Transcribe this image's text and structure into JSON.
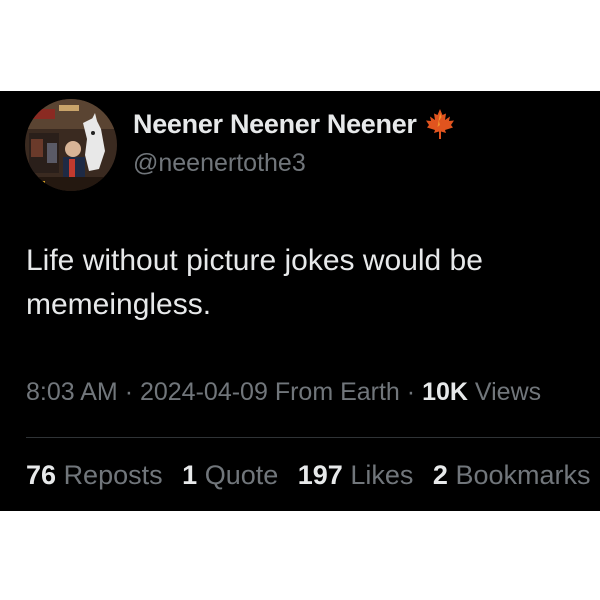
{
  "author": {
    "display_name": "Neener Neener Neener",
    "handle": "@neenertothe3",
    "badge_icon": "maple-leaf-icon",
    "badge_color": "#e0541f"
  },
  "tweet": {
    "text": "Life without picture jokes would be memeingless.",
    "time": "8:03 AM",
    "date": "2024-04-09",
    "source": "From Earth",
    "views_count": "10K",
    "views_label": "Views"
  },
  "stats": {
    "reposts_count": "76",
    "reposts_label": "Reposts",
    "quotes_count": "1",
    "quotes_label": "Quote",
    "likes_count": "197",
    "likes_label": "Likes",
    "bookmarks_count": "2",
    "bookmarks_label": "Bookmarks"
  },
  "colors": {
    "background": "#000000",
    "text_primary": "#e7e9ea",
    "text_secondary": "#71767b",
    "divider": "#2f3336"
  }
}
